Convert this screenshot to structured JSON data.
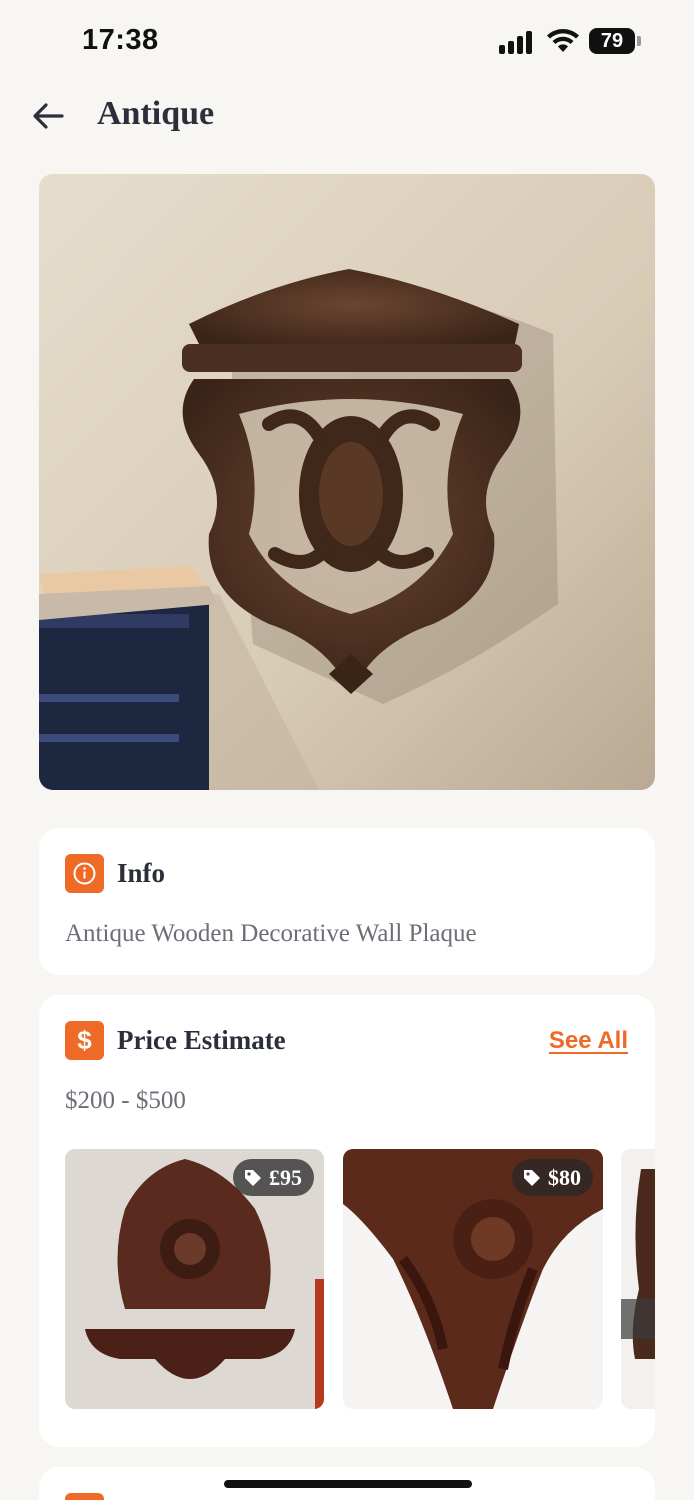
{
  "status": {
    "time": "17:38",
    "battery": "79"
  },
  "header": {
    "title": "Antique"
  },
  "info": {
    "title": "Info",
    "text": "Antique Wooden Decorative Wall Plaque"
  },
  "price": {
    "title": "Price Estimate",
    "see_all": "See All",
    "range": "$200 - $500",
    "items": [
      {
        "tag": "£95"
      },
      {
        "tag": "$80"
      }
    ]
  },
  "colors": {
    "accent": "#ee6a26",
    "background": "#f7f6f3"
  },
  "icons": [
    "back-arrow-icon",
    "info-icon",
    "dollar-icon",
    "price-tag-icon",
    "wifi-icon",
    "signal-icon",
    "battery-icon"
  ]
}
